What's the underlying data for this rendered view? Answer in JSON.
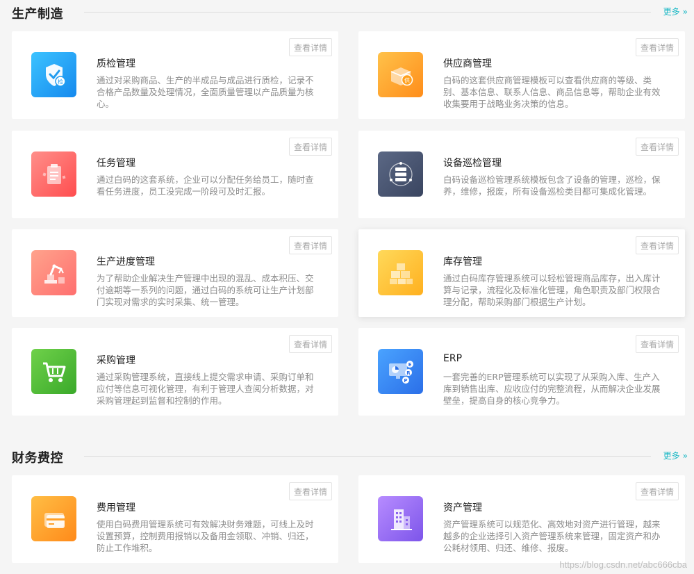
{
  "sections": [
    {
      "title": "生产制造",
      "more_label": "更多",
      "more_arrow": "»",
      "cards": [
        {
          "title": "质检管理",
          "desc": "通过对采购商品、生产的半成品与成品进行质检，记录不合格产品数量及处理情况，全面质量管理以产品质量为核心。",
          "button": "查看详情",
          "icon": "shield-check-icon",
          "icon_text": "检",
          "color": "#2aa8f5"
        },
        {
          "title": "供应商管理",
          "desc": "白码的这套供应商管理模板可以查看供应商的等级、类别、基本信息、联系人信息、商品信息等，帮助企业有效收集要用于战略业务决策的信息。",
          "button": "查看详情",
          "icon": "supplier-box-icon",
          "icon_text": "供",
          "color": "#ffa52b"
        },
        {
          "title": "任务管理",
          "desc": "通过白码的这套系统，企业可以分配任务给员工，随时查看任务进度，员工没完成一阶段可及时汇报。",
          "button": "查看详情",
          "icon": "clipboard-icon",
          "color": "#ff6b6b"
        },
        {
          "title": "设备巡检管理",
          "desc": "白码设备巡检管理系统模板包含了设备的管理，巡检，保养，维修，报废，所有设备巡检类目都可集成化管理。",
          "button": "查看详情",
          "icon": "server-rack-icon",
          "color": "#4b5873"
        },
        {
          "title": "生产进度管理",
          "desc": "为了帮助企业解决生产管理中出现的混乱、成本积压、交付逾期等一系列的问题，通过白码的系统可让生产计划部门实现对需求的实时采集、统一管理。",
          "button": "查看详情",
          "icon": "robot-arm-icon",
          "color": "#ff8a75"
        },
        {
          "title": "库存管理",
          "desc": "通过白码库存管理系统可以轻松管理商品库存，出入库计算与记录，流程化及标准化管理，角色职责及部门权限合理分配，帮助采购部门根据生产计划。",
          "button": "查看详情",
          "icon": "boxes-stack-icon",
          "color": "#ffc22e"
        },
        {
          "title": "采购管理",
          "desc": "通过采购管理系统，直接线上提交需求申请、采购订单和应付等信息可视化管理，有利于管理人查阅分析数据，对采购管理起到监督和控制的作用。",
          "button": "查看详情",
          "icon": "shopping-cart-icon",
          "color": "#52c238"
        },
        {
          "title": "ERP",
          "desc": "一套完善的ERP管理系统可以实现了从采购入库、生产入库到销售出库、应收应付的完整流程，从而解决企业发展壁垒，提高自身的核心竞争力。",
          "button": "查看详情",
          "icon": "erp-monitor-icon",
          "color": "#3b86f5"
        }
      ]
    },
    {
      "title": "财务费控",
      "more_label": "更多",
      "more_arrow": "»",
      "cards": [
        {
          "title": "费用管理",
          "desc": "使用白码费用管理系统可有效解决财务难题，可线上及时设置预算，控制费用报销以及备用金领取、冲销、归还，防止工作堆积。",
          "button": "查看详情",
          "icon": "credit-card-icon",
          "color": "#ffa029"
        },
        {
          "title": "资产管理",
          "desc": "资产管理系统可以规范化、高效地对资产进行管理，越来越多的企业选择引入资产管理系统来管理，固定资产和办公耗材领用、归还、维修、报废。",
          "button": "查看详情",
          "icon": "building-icon",
          "color": "#9a6cf2"
        }
      ]
    }
  ],
  "watermark": "https://blog.csdn.net/abc666cba"
}
